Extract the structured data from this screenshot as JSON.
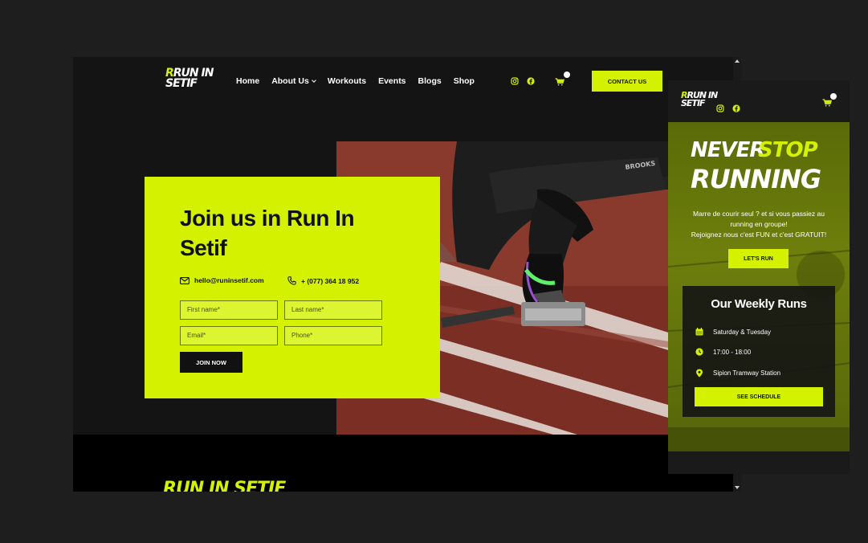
{
  "desktop": {
    "nav": {
      "logo_line1": "RUN IN",
      "logo_line2": "SETIF",
      "menu": [
        {
          "label": "Home"
        },
        {
          "label": "About Us"
        },
        {
          "label": "Workouts"
        },
        {
          "label": "Events"
        },
        {
          "label": "Blogs"
        },
        {
          "label": "Shop"
        }
      ],
      "contact_button": "CONTACT US"
    },
    "hero": {
      "title": "Join us in Run In Setif",
      "email": "hello@runinsetif.com",
      "phone": "+ (077) 364 18 952",
      "form": {
        "first_name_placeholder": "First name*",
        "last_name_placeholder": "Last name*",
        "email_placeholder": "Email*",
        "phone_placeholder": "Phone*",
        "submit": "JOIN NOW"
      }
    },
    "footer": {
      "logo": "RUN IN SETIF"
    }
  },
  "mobile": {
    "nav": {
      "logo_line1": "RUN IN",
      "logo_line2": "SETIF"
    },
    "hero": {
      "title_word1": "NEVER",
      "title_word2": "STOP",
      "title_word3": "RUNNING",
      "desc_line1": "Marre de courir seul ? et si vous passiez au",
      "desc_line2": "running en groupe!",
      "desc_line3": "Rejoignez nous c'est FUN et c'est GRATUIT!",
      "button": "LET'S RUN"
    },
    "weekly": {
      "title": "Our Weekly Runs",
      "items": [
        {
          "icon": "calendar-icon",
          "text": "Saturday & Tuesday"
        },
        {
          "icon": "clock-icon",
          "text": "17:00 - 18:00"
        },
        {
          "icon": "location-pin-icon",
          "text": "Sipion Tramway Station"
        }
      ],
      "button": "SEE SCHEDULE"
    }
  },
  "colors": {
    "accent": "#d4f200",
    "dark": "#141414"
  }
}
